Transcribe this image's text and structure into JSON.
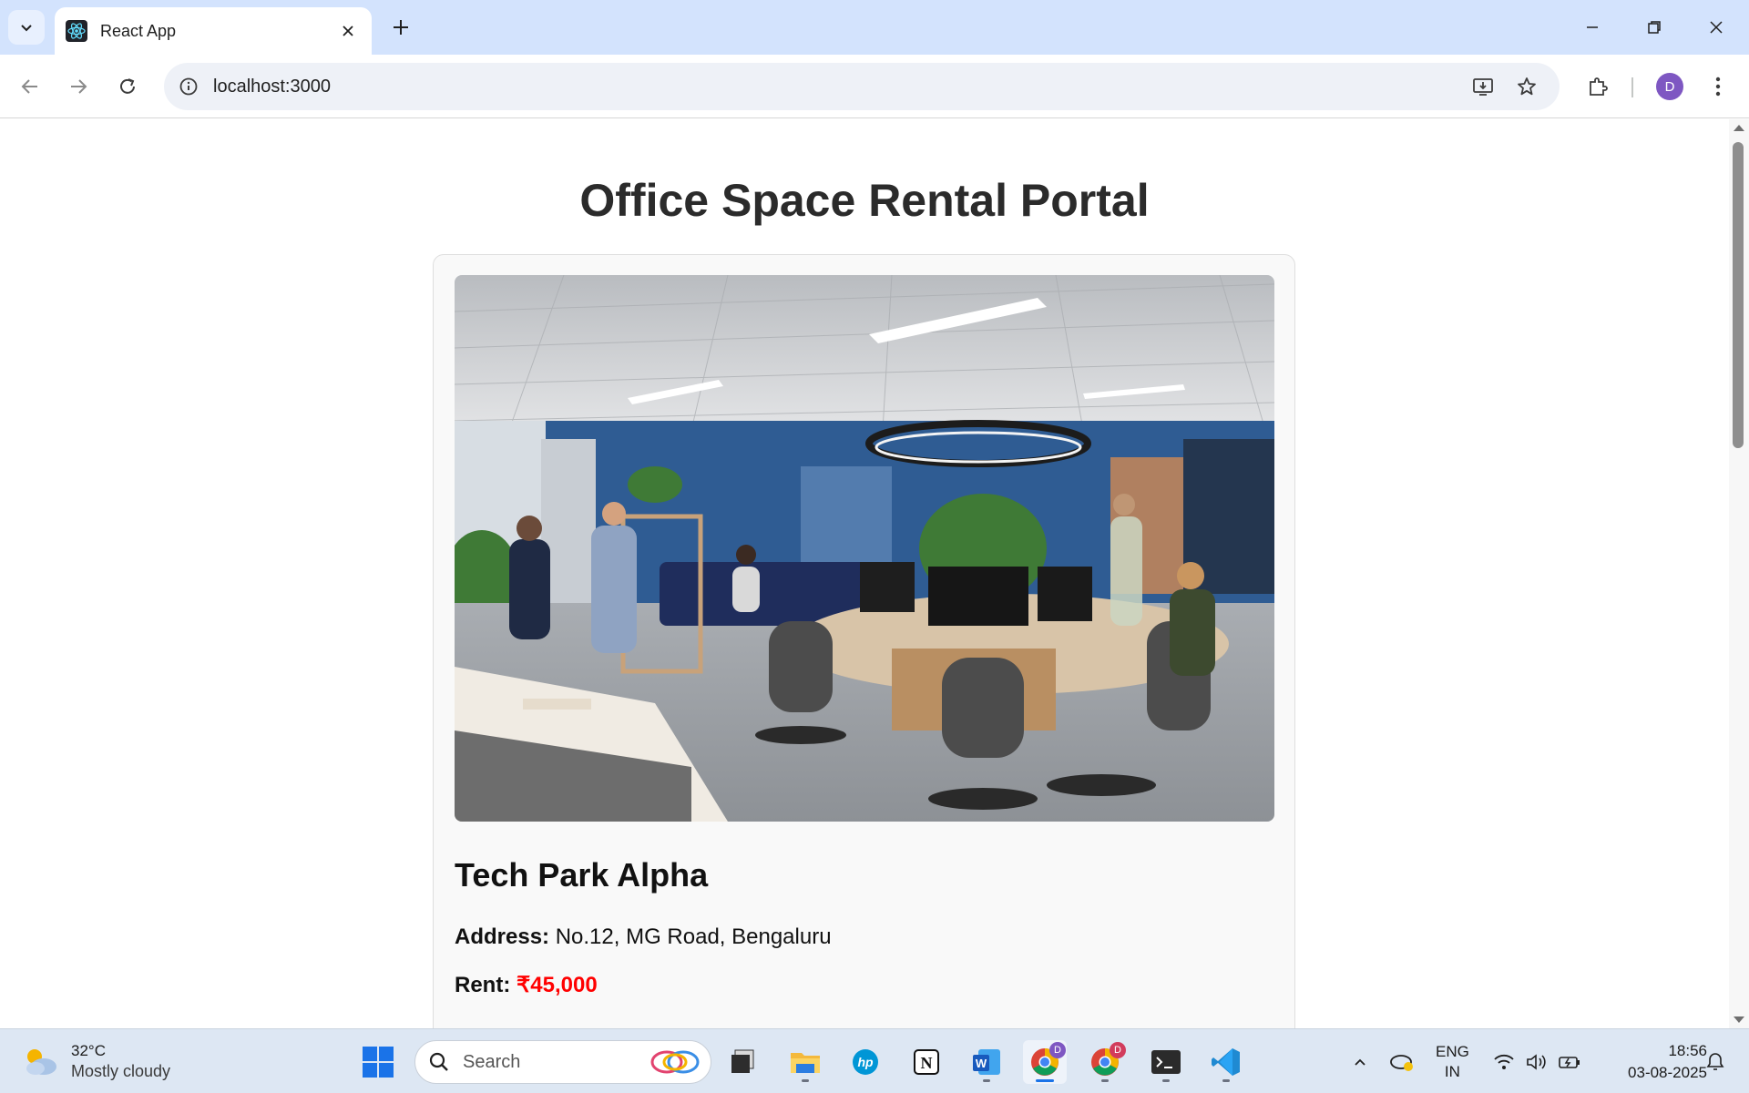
{
  "browser": {
    "tab_title": "React App",
    "url": "localhost:3000",
    "profile_initial": "D"
  },
  "page": {
    "title": "Office Space Rental Portal",
    "card": {
      "name": "Tech Park Alpha",
      "address_label": "Address:",
      "address_value": "No.12, MG Road, Bengaluru",
      "rent_label": "Rent:",
      "rent_value": "₹45,000",
      "rent_color": "#ff0000"
    }
  },
  "taskbar": {
    "weather_temp": "32°C",
    "weather_desc": "Mostly cloudy",
    "search_placeholder": "Search",
    "badge_chrome_1": "D",
    "badge_chrome_2": "D",
    "lang_line1": "ENG",
    "lang_line2": "IN",
    "time": "18:56",
    "date": "03-08-2025"
  },
  "colors": {
    "tabbar": "#d3e3fd",
    "accent": "#1a73e8",
    "avatar": "#7e57c2"
  }
}
